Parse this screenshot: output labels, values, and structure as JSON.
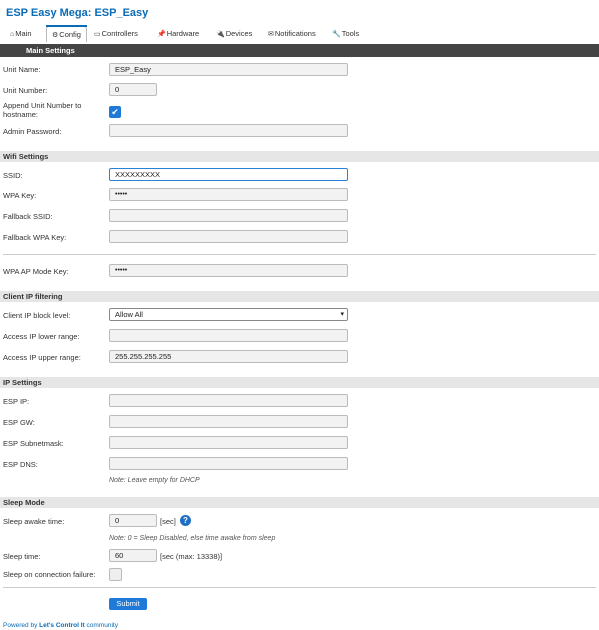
{
  "app": {
    "title": "ESP Easy Mega: ESP_Easy"
  },
  "tabs": [
    {
      "icon": "⌂",
      "label": "Main"
    },
    {
      "icon": "⚙",
      "label": "Config"
    },
    {
      "icon": "▭",
      "label": "Controllers"
    },
    {
      "icon": "📌",
      "label": "Hardware"
    },
    {
      "icon": "🔌",
      "label": "Devices"
    },
    {
      "icon": "✉",
      "label": "Notifications"
    },
    {
      "icon": "🔧",
      "label": "Tools"
    }
  ],
  "main_settings": {
    "header": "Main Settings",
    "unit_name_label": "Unit Name:",
    "unit_name_value": "ESP_Easy",
    "unit_number_label": "Unit Number:",
    "unit_number_value": "0",
    "append_label_1": "Append Unit Number to",
    "append_label_2": "hostname:",
    "append_checked": true,
    "admin_password_label": "Admin Password:",
    "admin_password_value": ""
  },
  "wifi": {
    "header": "Wifi Settings",
    "ssid_label": "SSID:",
    "ssid_value": "XXXXXXXXX",
    "wpa_key_label": "WPA Key:",
    "wpa_key_value": "•••••",
    "fallback_ssid_label": "Fallback SSID:",
    "fallback_ssid_value": "",
    "fallback_wpa_label": "Fallback WPA Key:",
    "fallback_wpa_value": "",
    "ap_key_label": "WPA AP Mode Key:",
    "ap_key_value": "•••••"
  },
  "client_ip": {
    "header": "Client IP filtering",
    "block_level_label": "Client IP block level:",
    "block_level_value": "Allow All",
    "lower_label": "Access IP lower range:",
    "lower_value": "",
    "upper_label": "Access IP upper range:",
    "upper_value": "255.255.255.255"
  },
  "ip_settings": {
    "header": "IP Settings",
    "ip_label": "ESP IP:",
    "gw_label": "ESP GW:",
    "subnet_label": "ESP Subnetmask:",
    "dns_label": "ESP DNS:",
    "note": "Note: Leave empty for DHCP"
  },
  "sleep": {
    "header": "Sleep Mode",
    "awake_label": "Sleep awake time:",
    "awake_value": "0",
    "awake_unit": "[sec]",
    "awake_note": "Note: 0 = Sleep Disabled, else time awake from sleep",
    "sleep_time_label": "Sleep time:",
    "sleep_time_value": "60",
    "sleep_time_unit": "[sec (max: 13338)]",
    "on_failure_label": "Sleep on connection failure:",
    "on_failure_checked": false
  },
  "submit_label": "Submit",
  "footer": {
    "prefix": "Powered by ",
    "brand": "Let's Control It",
    "suffix": " community"
  },
  "help_icon": "?",
  "colors": {
    "accent": "#0a6bb6",
    "button": "#1e7ad6",
    "header_dark": "#444444"
  }
}
